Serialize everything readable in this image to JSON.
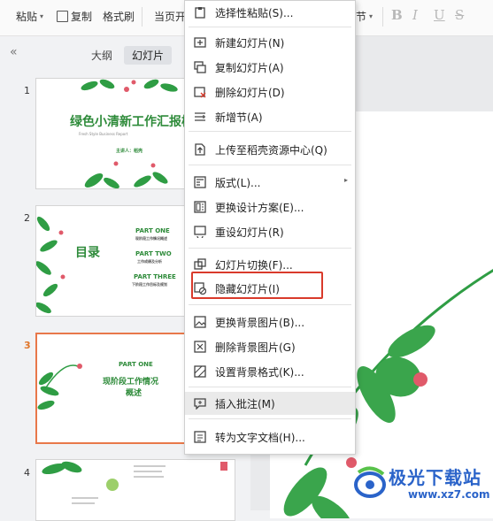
{
  "ribbon": {
    "paste": "粘贴",
    "copy": "复制",
    "format_painter": "格式刷",
    "from_current_page": "当页开",
    "section": "节",
    "format_buttons": [
      "B",
      "I",
      "U",
      "S"
    ]
  },
  "panel": {
    "tabs": [
      "大纲",
      "幻灯片"
    ],
    "active_tab": "幻灯片"
  },
  "slides": [
    {
      "number": "1",
      "title": "绿色小清新工作汇报模",
      "subtitle": "Fresh Style Business Report",
      "presenter": "主讲人：稻壳"
    },
    {
      "number": "2",
      "heading": "目录",
      "parts": [
        {
          "part": "PART ONE",
          "desc": "现阶段工作情况概述"
        },
        {
          "part": "PART TWO",
          "desc": "工作成绩及分析"
        },
        {
          "part": "PART THREE",
          "desc": "下阶段工作目标及规划"
        }
      ]
    },
    {
      "number": "3",
      "part": "PART ONE",
      "title_line1": "现阶段工作情况",
      "title_line2": "概述"
    },
    {
      "number": "4"
    }
  ],
  "context_menu": {
    "items": [
      {
        "label": "选择性粘贴(S)...",
        "icon": "paste-special-icon"
      },
      {
        "label": "新建幻灯片(N)",
        "icon": "new-slide-icon"
      },
      {
        "label": "复制幻灯片(A)",
        "icon": "copy-slide-icon"
      },
      {
        "label": "删除幻灯片(D)",
        "icon": "delete-slide-icon"
      },
      {
        "label": "新增节(A)",
        "icon": "new-section-icon"
      },
      {
        "label": "上传至稻壳资源中心(Q)",
        "icon": "upload-icon"
      },
      {
        "label": "版式(L)...",
        "icon": "layout-icon",
        "submenu": true
      },
      {
        "label": "更换设计方案(E)...",
        "icon": "design-icon"
      },
      {
        "label": "重设幻灯片(R)",
        "icon": "reset-slide-icon"
      },
      {
        "label": "幻灯片切换(F)...",
        "icon": "transition-icon"
      },
      {
        "label": "隐藏幻灯片(I)",
        "icon": "hide-slide-icon"
      },
      {
        "label": "更换背景图片(B)...",
        "icon": "change-background-icon"
      },
      {
        "label": "删除背景图片(G)",
        "icon": "delete-background-icon"
      },
      {
        "label": "设置背景格式(K)...",
        "icon": "background-format-icon"
      },
      {
        "label": "插入批注(M)",
        "icon": "comment-icon"
      },
      {
        "label": "转为文字文档(H)...",
        "icon": "convert-doc-icon"
      }
    ],
    "highlighted": "插入批注(M)",
    "boxed": "隐藏幻灯片(I)"
  },
  "watermark": {
    "title": "极光下载站",
    "url": "www.xz7.com"
  },
  "colors": {
    "accent_green": "#2e8b3a",
    "highlight_box": "#d93a2b",
    "active_slide_border": "#e8784a"
  }
}
